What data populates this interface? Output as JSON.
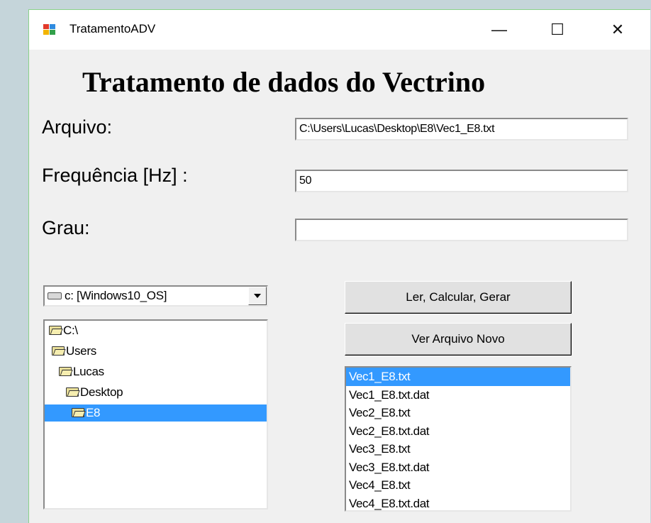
{
  "window": {
    "title": "TratamentoADV",
    "controls": {
      "minimize": "—",
      "maximize": "☐",
      "close": "✕"
    }
  },
  "heading": "Tratamento de dados do Vectrino",
  "form": {
    "arquivo_label": "Arquivo:",
    "arquivo_value": "C:\\Users\\Lucas\\Desktop\\E8\\Vec1_E8.txt",
    "frequencia_label": "Frequência [Hz] :",
    "frequencia_value": "50",
    "grau_label": "Grau:",
    "grau_value": ""
  },
  "drive_select": {
    "icon": "drive-icon",
    "value": "c: [Windows10_OS]"
  },
  "directory_tree": {
    "items": [
      {
        "label": "C:\\",
        "icon": "folder-open-icon"
      },
      {
        "label": "Users",
        "icon": "folder-open-icon"
      },
      {
        "label": "Lucas",
        "icon": "folder-open-icon"
      },
      {
        "label": "Desktop",
        "icon": "folder-open-icon"
      },
      {
        "label": "E8",
        "icon": "folder-open-icon",
        "selected": true
      }
    ]
  },
  "buttons": {
    "process_label": "Ler, Calcular, Gerar",
    "view_new_label": "Ver Arquivo Novo"
  },
  "file_list": {
    "items": [
      "Vec1_E8.txt",
      "Vec1_E8.txt.dat",
      "Vec2_E8.txt",
      "Vec2_E8.txt.dat",
      "Vec3_E8.txt",
      "Vec3_E8.txt.dat",
      "Vec4_E8.txt",
      "Vec4_E8.txt.dat"
    ],
    "selected_index": 0
  },
  "colors": {
    "selection": "#3399ff",
    "window_bg": "#f0f0f0",
    "desktop_bg": "#c5d5da"
  }
}
